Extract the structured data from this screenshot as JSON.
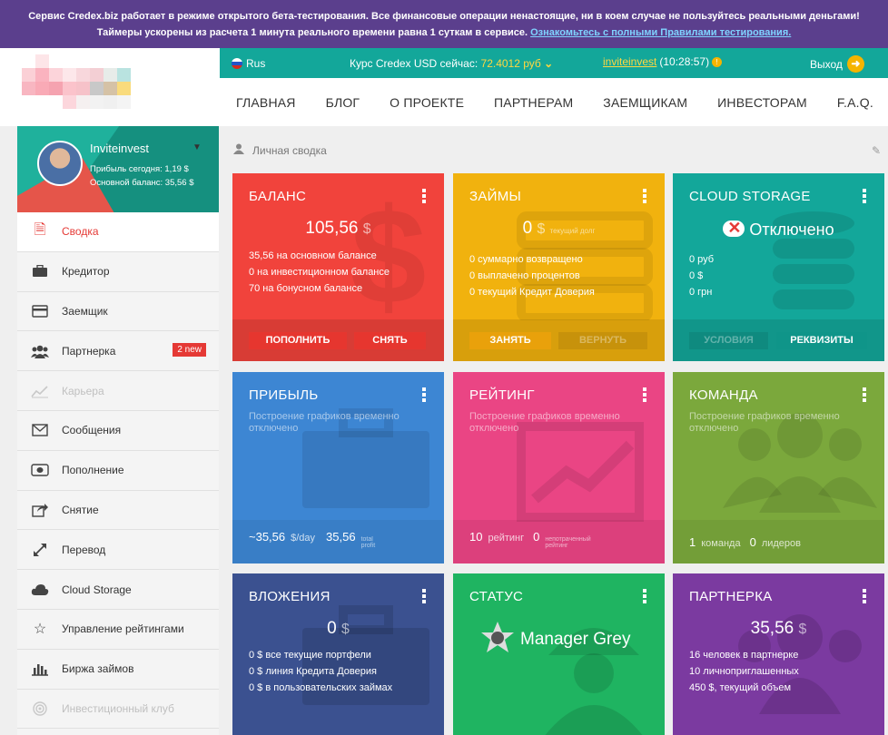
{
  "banner": {
    "line1": "Сервис Credex.biz работает в режиме открытого бета-тестирования. Все финансовые операции ненастоящие, ни в коем случае не пользуйтесь реальными деньгами!",
    "line2": "Таймеры ускорены из расчета 1 минута реального времени равна 1 суткам в сервисе.",
    "link": "Ознакомьтесь с полными Правилами тестирования."
  },
  "topbar": {
    "lang": "Rus",
    "rate_label": "Курс Credex USD сейчас:",
    "rate_value": "72.4012 руб",
    "username": "inviteinvest",
    "time": "(10:28:57)",
    "logout": "Выход"
  },
  "nav": [
    "ГЛАВНАЯ",
    "БЛОГ",
    "О ПРОЕКТЕ",
    "ПАРТНЕРАМ",
    "ЗАЕМЩИКАМ",
    "ИНВЕСТОРАМ",
    "F.A.Q."
  ],
  "profile": {
    "name": "Inviteinvest",
    "profit_today": "Прибыль сегодня: 1,19 $",
    "main_balance": "Основной баланс: 35,56 $"
  },
  "menu": [
    {
      "label": "Сводка",
      "icon": "document-icon"
    },
    {
      "label": "Кредитор",
      "icon": "briefcase-icon"
    },
    {
      "label": "Заемщик",
      "icon": "credit-card-icon"
    },
    {
      "label": "Партнерка",
      "icon": "users-icon",
      "badge": "2 new"
    },
    {
      "label": "Карьера",
      "icon": "chart-line-icon"
    },
    {
      "label": "Сообщения",
      "icon": "envelope-icon"
    },
    {
      "label": "Пополнение",
      "icon": "money-icon"
    },
    {
      "label": "Снятие",
      "icon": "share-icon"
    },
    {
      "label": "Перевод",
      "icon": "arrows-icon"
    },
    {
      "label": "Cloud Storage",
      "icon": "cloud-icon"
    },
    {
      "label": "Управление рейтингами",
      "icon": "star-icon"
    },
    {
      "label": "Биржа займов",
      "icon": "bar-chart-icon"
    },
    {
      "label": "Инвестиционный клуб",
      "icon": "target-icon"
    }
  ],
  "breadcrumb": "Личная сводка",
  "cards": {
    "balance": {
      "title": "БАЛАНС",
      "value": "105,56",
      "currency": "$",
      "lines": [
        "35,56 на основном балансе",
        "0 на инвестиционном балансе",
        "70 на бонусном балансе"
      ],
      "btn1": "ПОПОЛНИТЬ",
      "btn2": "СНЯТЬ",
      "color": "#f1433c"
    },
    "loans": {
      "title": "ЗАЙМЫ",
      "value": "0",
      "currency": "$",
      "sub": "текущий долг",
      "lines": [
        "0 суммарно возвращено",
        "0 выплачено процентов",
        "0 текущий Кредит Доверия"
      ],
      "btn1": "ЗАНЯТЬ",
      "btn2": "ВЕРНУТЬ",
      "color": "#f1b20e"
    },
    "cloud": {
      "title": "CLOUD STORAGE",
      "status": "Отключено",
      "lines": [
        "0 руб",
        "0 $",
        "0 грн"
      ],
      "btn1": "УСЛОВИЯ",
      "btn2": "РЕКВИЗИТЫ",
      "color": "#13a79a"
    },
    "profit": {
      "title": "ПРИБЫЛЬ",
      "note": "Построение графиков временно отключено",
      "daily": "~35,56",
      "daily_unit": "$/day",
      "total": "35,56",
      "total_label1": "total",
      "total_label2": "profit",
      "color": "#3d86d3"
    },
    "rating": {
      "title": "РЕЙТИНГ",
      "note": "Построение графиков временно отключено",
      "rating": "10",
      "rating_label": "рейтинг",
      "unspent": "0",
      "unspent_label1": "непотраченный",
      "unspent_label2": "рейтинг",
      "color": "#ea4584"
    },
    "team": {
      "title": "КОМАНДА",
      "note": "Построение графиков временно отключено",
      "team": "1",
      "team_label": "команда",
      "leaders": "0",
      "leaders_label": "лидеров",
      "color": "#7ba83c"
    },
    "investments": {
      "title": "ВЛОЖЕНИЯ",
      "value": "0",
      "currency": "$",
      "lines": [
        "0 $ все текущие портфели",
        "0 $ линия Кредита Доверия",
        "0 $ в пользовательских займах"
      ],
      "color": "#3b5190"
    },
    "status": {
      "title": "СТАТУС",
      "status": "Manager Grey",
      "color": "#1fb461"
    },
    "partner": {
      "title": "ПАРТНЕРКА",
      "value": "35,56",
      "currency": "$",
      "lines": [
        "16 человек в партнерке",
        "10 личноприглашенных",
        "450 $, текущий объем"
      ],
      "color": "#7b3aa0"
    }
  }
}
